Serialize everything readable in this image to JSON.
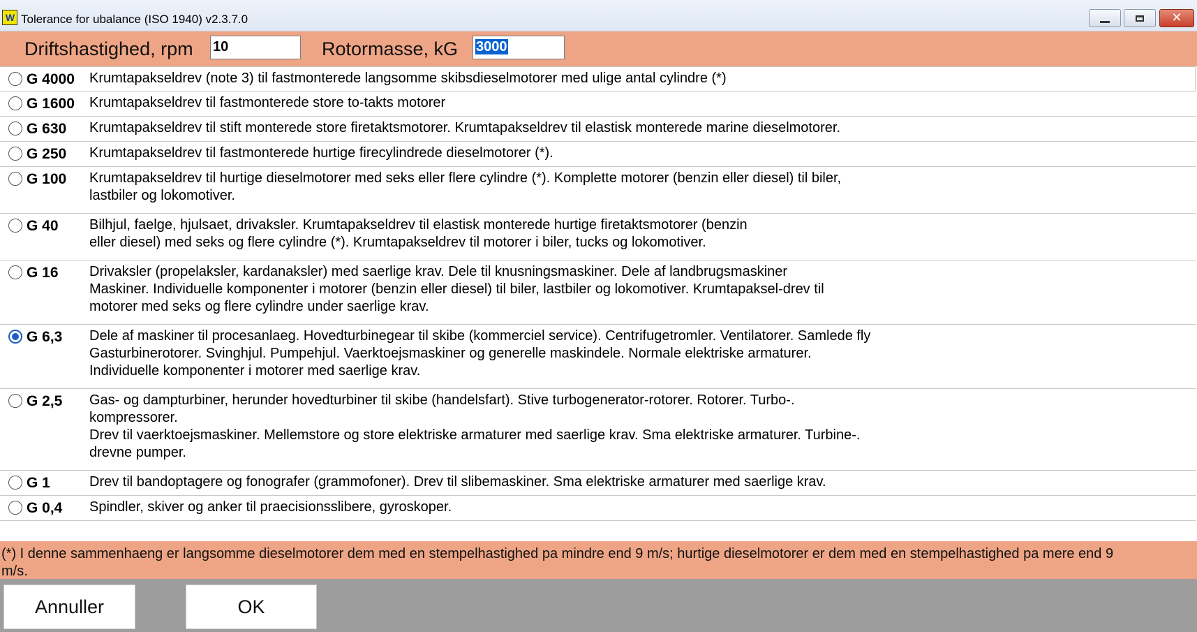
{
  "window": {
    "title": "Tolerance for ubalance (ISO 1940) v2.3.7.0",
    "icon_text": "W",
    "controls": [
      "minimize-icon",
      "maximize-icon",
      "close-icon"
    ]
  },
  "header": {
    "speed_label": "Driftshastighed, rpm",
    "speed_value": "10",
    "mass_label": "Rotormasse, kG",
    "mass_value": "3000"
  },
  "grades": [
    {
      "grade": "G 4000",
      "selected": false,
      "lines": [
        "Krumtapakseldrev (note 3) til fastmonterede langsomme skibsdieselmotorer med ulige antal cylindre (*)"
      ]
    },
    {
      "grade": "G 1600",
      "selected": false,
      "lines": [
        "Krumtapakseldrev til fastmonterede store to-takts motorer"
      ]
    },
    {
      "grade": "G 630",
      "selected": false,
      "lines": [
        "Krumtapakseldrev til stift monterede store firetaktsmotorer. Krumtapakseldrev til elastisk monterede marine dieselmotorer."
      ]
    },
    {
      "grade": "G 250",
      "selected": false,
      "lines": [
        "Krumtapakseldrev til fastmonterede hurtige firecylindrede dieselmotorer (*)."
      ]
    },
    {
      "grade": "G 100",
      "selected": false,
      "lines": [
        "Krumtapakseldrev til hurtige dieselmotorer med seks eller flere cylindre (*). Komplette motorer (benzin eller diesel) til biler,",
        "lastbiler og lokomotiver."
      ]
    },
    {
      "grade": "G 40",
      "selected": false,
      "lines": [
        "Bilhjul, faelge, hjulsaet, drivaksler. Krumtapakseldrev til elastisk monterede hurtige firetaktsmotorer (benzin",
        "eller diesel) med seks og flere cylindre (*). Krumtapakseldrev til motorer i biler, tucks og lokomotiver."
      ]
    },
    {
      "grade": "G 16",
      "selected": false,
      "lines": [
        "Drivaksler (propelaksler, kardanaksler) med saerlige krav. Dele til knusningsmaskiner. Dele af landbrugsmaskiner",
        "Maskiner. Individuelle komponenter i motorer (benzin eller diesel) til biler, lastbiler og lokomotiver. Krumtapaksel-drev til",
        "motorer med seks og flere cylindre under saerlige krav."
      ]
    },
    {
      "grade": "G 6,3",
      "selected": true,
      "lines": [
        " Dele af maskiner til procesanlaeg. Hovedturbinegear til skibe (kommerciel service). Centrifugetromler. Ventilatorer. Samlede fly",
        "Gasturbinerotorer. Svinghjul. Pumpehjul. Vaerktoejsmaskiner og generelle maskindele. Normale elektriske armaturer.",
        "Individuelle komponenter i motorer med saerlige krav."
      ]
    },
    {
      "grade": "G 2,5",
      "selected": false,
      "lines": [
        "Gas- og dampturbiner, herunder hovedturbiner til skibe (handelsfart). Stive turbogenerator-rotorer. Rotorer. Turbo-.",
        "kompressorer.",
        "Drev til vaerktoejsmaskiner. Mellemstore og store elektriske armaturer med saerlige krav. Sma elektriske armaturer. Turbine-.",
        "drevne pumper."
      ]
    },
    {
      "grade": "G 1",
      "selected": false,
      "lines": [
        "Drev til bandoptagere og fonografer (grammofoner). Drev til slibemaskiner. Sma elektriske armaturer med saerlige krav."
      ]
    },
    {
      "grade": "G 0,4",
      "selected": false,
      "lines": [
        "Spindler, skiver og anker til praecisionsslibere, gyroskoper."
      ]
    }
  ],
  "footnote": {
    "line1": "(*) I denne sammenhaeng er langsomme dieselmotorer dem med en stempelhastighed pa mindre end 9 m/s; hurtige dieselmotorer er dem med en stempelhastighed pa mere end 9",
    "line2": "m/s."
  },
  "buttons": {
    "cancel": "Annuller",
    "ok": "OK"
  }
}
